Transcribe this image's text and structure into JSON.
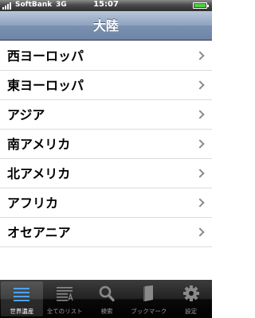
{
  "status_bar": {
    "carrier": "SoftBank",
    "network": "3G",
    "time": "15:07",
    "battery_level": 1.0
  },
  "nav": {
    "title": "大陸"
  },
  "list": {
    "items": [
      {
        "label": "西ヨーロッパ"
      },
      {
        "label": "東ヨーロッパ"
      },
      {
        "label": "アジア"
      },
      {
        "label": "南アメリカ"
      },
      {
        "label": "北アメリカ"
      },
      {
        "label": "アフリカ"
      },
      {
        "label": "オセアニア"
      }
    ]
  },
  "tab_bar": {
    "tabs": [
      {
        "label": "世界遺産",
        "icon": "list-icon",
        "selected": true
      },
      {
        "label": "全てのリスト",
        "icon": "alphabet-list-icon",
        "selected": false
      },
      {
        "label": "検索",
        "icon": "search-icon",
        "selected": false
      },
      {
        "label": "ブックマーク",
        "icon": "book-icon",
        "selected": false
      },
      {
        "label": "設定",
        "icon": "gear-icon",
        "selected": false
      }
    ]
  },
  "colors": {
    "nav_bar": "#8ea2bf",
    "tab_selected_text": "#ffffff",
    "tab_text": "#9a9a9a",
    "battery": "#4cd23a"
  }
}
